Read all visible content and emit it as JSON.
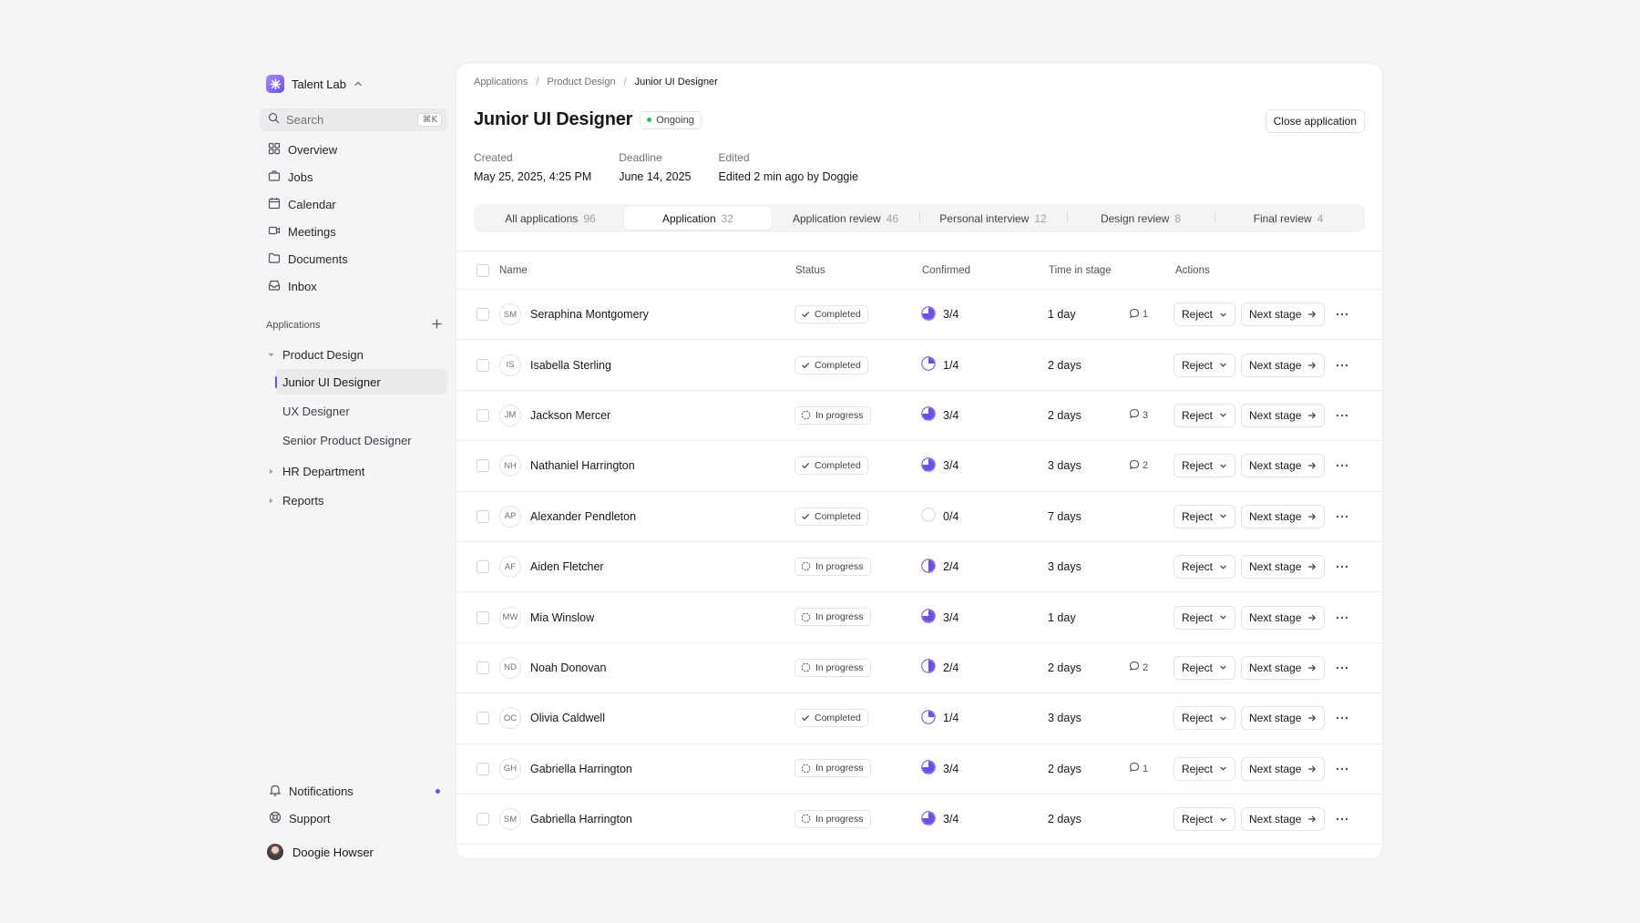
{
  "app": {
    "name": "Talent Lab",
    "brand_color": "#6d4ee8"
  },
  "search": {
    "placeholder": "Search",
    "shortcut": "⌘K"
  },
  "nav": [
    {
      "label": "Overview",
      "icon": "grid-icon"
    },
    {
      "label": "Jobs",
      "icon": "briefcase-icon"
    },
    {
      "label": "Calendar",
      "icon": "calendar-icon"
    },
    {
      "label": "Meetings",
      "icon": "video-icon"
    },
    {
      "label": "Documents",
      "icon": "folder-icon"
    },
    {
      "label": "Inbox",
      "icon": "inbox-icon"
    }
  ],
  "applications_section": {
    "title": "Applications",
    "groups": [
      {
        "label": "Product Design",
        "expanded": true,
        "children": [
          "Junior UI Designer",
          "UX Designer",
          "Senior Product Designer"
        ],
        "active_child": "Junior UI Designer"
      },
      {
        "label": "HR Department",
        "expanded": false
      },
      {
        "label": "Reports",
        "expanded": false
      }
    ]
  },
  "bottom": {
    "notifications": "Notifications",
    "support": "Support",
    "user_name": "Doogie Howser"
  },
  "breadcrumb": [
    "Applications",
    "Product Design",
    "Junior UI Designer"
  ],
  "page": {
    "title": "Junior UI Designer",
    "status": "Ongoing",
    "close_label": "Close application",
    "meta": [
      {
        "label": "Created",
        "value": "May 25, 2025, 4:25 PM"
      },
      {
        "label": "Deadline",
        "value": "June 14, 2025"
      },
      {
        "label": "Edited",
        "value": "Edited 2 min ago by Doggie"
      }
    ]
  },
  "tabs": [
    {
      "label": "All applications",
      "count": "96",
      "active": false
    },
    {
      "label": "Application",
      "count": "32",
      "active": true
    },
    {
      "label": "Application review",
      "count": "46",
      "active": false
    },
    {
      "label": "Personal interview",
      "count": "12",
      "active": false
    },
    {
      "label": "Design review",
      "count": "8",
      "active": false
    },
    {
      "label": "Final review",
      "count": "4",
      "active": false
    }
  ],
  "table": {
    "headers": {
      "name": "Name",
      "status": "Status",
      "confirmed": "Confirmed",
      "time": "Time in stage",
      "actions": "Actions"
    },
    "reject_label": "Reject",
    "next_label": "Next stage",
    "rows": [
      {
        "initials": "SM",
        "name": "Seraphina Montgomery",
        "status": "Completed",
        "confirmed": "3/4",
        "time": "1 day",
        "comments": "1"
      },
      {
        "initials": "IS",
        "name": "Isabella Sterling",
        "status": "Completed",
        "confirmed": "1/4",
        "time": "2 days",
        "comments": ""
      },
      {
        "initials": "JM",
        "name": "Jackson Mercer",
        "status": "In progress",
        "confirmed": "3/4",
        "time": "2 days",
        "comments": "3"
      },
      {
        "initials": "NH",
        "name": "Nathaniel Harrington",
        "status": "Completed",
        "confirmed": "3/4",
        "time": "3 days",
        "comments": "2"
      },
      {
        "initials": "AP",
        "name": "Alexander Pendleton",
        "status": "Completed",
        "confirmed": "0/4",
        "time": "7 days",
        "comments": ""
      },
      {
        "initials": "AF",
        "name": "Aiden Fletcher",
        "status": "In progress",
        "confirmed": "2/4",
        "time": "3 days",
        "comments": ""
      },
      {
        "initials": "MW",
        "name": "Mia Winslow",
        "status": "In progress",
        "confirmed": "3/4",
        "time": "1 day",
        "comments": ""
      },
      {
        "initials": "ND",
        "name": "Noah Donovan",
        "status": "In progress",
        "confirmed": "2/4",
        "time": "2 days",
        "comments": "2"
      },
      {
        "initials": "OC",
        "name": "Olivia Caldwell",
        "status": "Completed",
        "confirmed": "1/4",
        "time": "3 days",
        "comments": ""
      },
      {
        "initials": "GH",
        "name": "Gabriella Harrington",
        "status": "In progress",
        "confirmed": "3/4",
        "time": "2 days",
        "comments": "1"
      },
      {
        "initials": "SM",
        "name": "Gabriella Harrington",
        "status": "In progress",
        "confirmed": "3/4",
        "time": "2 days",
        "comments": ""
      }
    ]
  }
}
